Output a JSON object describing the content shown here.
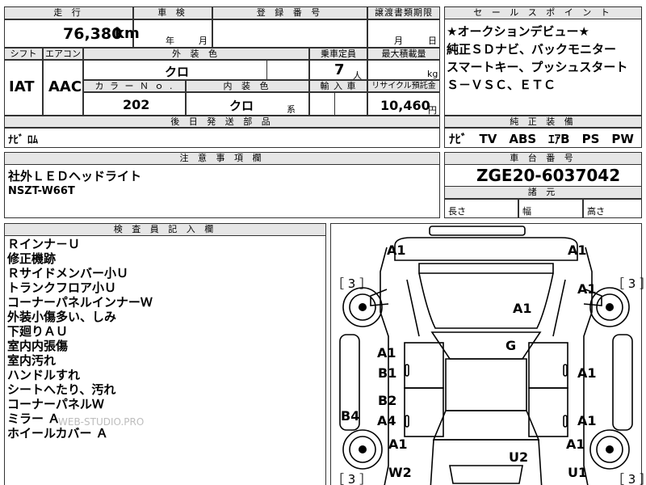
{
  "spec": {
    "mileage": {
      "label": "走 行",
      "value": "76,380",
      "unit": "km"
    },
    "inspection": {
      "label": "車 検",
      "year_unit": "年",
      "month_unit": "月"
    },
    "registration": {
      "label": "登 録 番 号"
    },
    "transfer": {
      "label": "譲渡書類期限",
      "month_unit": "月",
      "day_unit": "日"
    },
    "shift": {
      "label": "シフト",
      "value": "IAT"
    },
    "aircon": {
      "label": "エアコン",
      "value": "AAC"
    },
    "exterior_color": {
      "label": "外 装 色",
      "value": "クロ"
    },
    "capacity": {
      "label": "乗車定員",
      "value": "7",
      "unit": "人"
    },
    "max_load": {
      "label": "最大積載量",
      "unit": "kg"
    },
    "color_no": {
      "label": "カ ラ ー Ｎ ｏ .",
      "value": "202"
    },
    "interior_color": {
      "label": "内 装 色",
      "value": "クロ",
      "unit": "系"
    },
    "import": {
      "label": "輸 入 車"
    },
    "recycle": {
      "label": "リサイクル預託金",
      "value": "10,460",
      "unit": "円"
    },
    "later_parts": {
      "label": "後 日 発 送 部 品",
      "value": "ﾅﾋﾞ ﾛﾑ"
    }
  },
  "sales_points": {
    "label": "セ ー ル ス ポ イ ン ト",
    "lines": [
      "★オークションデビュー★",
      "純正ＳＤナビ、バックモニター",
      "スマートキー、プッシュスタート",
      "Ｓ－ＶＳＣ、ＥＴＣ"
    ]
  },
  "equipment": {
    "label": "純 正 装 備",
    "value": "ﾅﾋﾞ　TV　ABS　ｴｱB　PS　PW"
  },
  "caution": {
    "label": "注 意 事 項 欄",
    "lines": [
      "社外ＬＥＤヘッドライト",
      "NSZT-W66T"
    ]
  },
  "chassis": {
    "label": "車 台 番 号",
    "value": "ZGE20-6037042"
  },
  "dimensions": {
    "label": "諸 元",
    "length": "長さ",
    "width": "幅",
    "height": "高さ"
  },
  "inspector": {
    "label": "検 査 員 記 入 欄",
    "lines": [
      "Ｒインナ－Ｕ",
      "修正機跡",
      "Ｒサイドメンバー小Ｕ",
      "トランクフロア小Ｕ",
      "コーナーパネルインナーＷ",
      "外装小傷多い、しみ",
      "下廻りＡＵ",
      "室内内張傷",
      "室内汚れ",
      "ハンドルすれ",
      "シートへたり、汚れ",
      "コーナーパネルＷ",
      "ミラー Ａ",
      "ホイールカバー Ａ"
    ],
    "watermark": "WEB-STUDIO.PRO"
  },
  "diagram": {
    "marks": {
      "a1_top_left": "A1",
      "a1_top_right": "A1",
      "b3_left": "［ 3 ］",
      "b3_right": "［ 3 ］",
      "a1_right_front": "A1",
      "a1_hood": "A1",
      "g_windshield": "G",
      "a1_left_door": "A1",
      "b1_left_door": "B1",
      "a1_right_door1": "A1",
      "b2_left_rear": "B2",
      "a4_left_rear": "A4",
      "b4_left": "B4",
      "a1_right_door2": "A1",
      "a1_left_bottom": "A1",
      "a1_right_bottom": "A1",
      "w2": "W2",
      "u2": "U2",
      "u1": "U1",
      "b3_bl": "［ 3 ］",
      "b3_br": "［ 3 ］"
    }
  }
}
